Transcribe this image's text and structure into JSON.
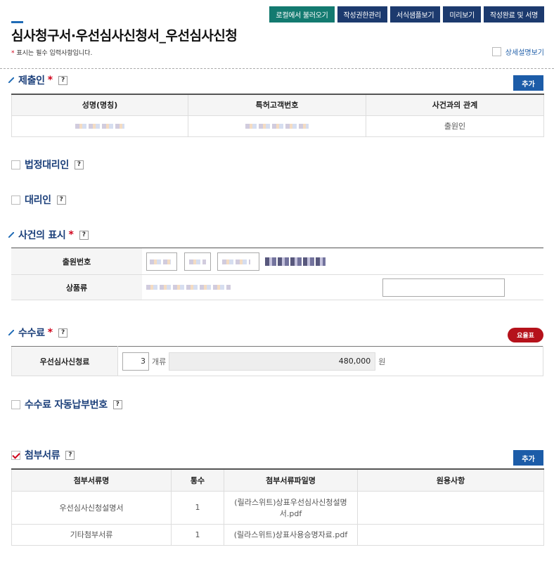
{
  "header": {
    "title": "심사청구서·우선심사신청서_우선심사신청",
    "required_note_star": "*",
    "required_note": "표시는 필수 입력사항입니다.",
    "detail_toggle_label": "상세설명보기"
  },
  "top_buttons": [
    {
      "label": "로컬에서 불러오기"
    },
    {
      "label": "작성권한관리"
    },
    {
      "label": "서식샘플보기"
    },
    {
      "label": "미리보기"
    },
    {
      "label": "작성완료 및 서명"
    }
  ],
  "sections": {
    "submitter": {
      "title": "제출인",
      "required": "*",
      "help": "?",
      "add_label": "추가"
    },
    "legal_agent": {
      "title": "법정대리인",
      "help": "?"
    },
    "agent": {
      "title": "대리인",
      "help": "?"
    },
    "case": {
      "title": "사건의 표시",
      "required": "*",
      "help": "?"
    },
    "fee": {
      "title": "수수료",
      "required": "*",
      "help": "?",
      "fee_table_label": "요율표"
    },
    "auto_pay": {
      "title": "수수료 자동납부번호",
      "help": "?"
    },
    "attachments": {
      "title": "첨부서류",
      "help": "?",
      "add_label": "추가"
    }
  },
  "submitter_table": {
    "headers": [
      "성명(명칭)",
      "특허고객번호",
      "사건과의 관계"
    ],
    "rows": [
      {
        "relation": "출원인"
      }
    ]
  },
  "case_table": {
    "rows": [
      {
        "label": "출원번호"
      },
      {
        "label": "상품류"
      }
    ]
  },
  "fee_table": {
    "label": "우선심사신청료",
    "quantity": "3",
    "quantity_unit": "개류",
    "amount": "480,000",
    "amount_unit": "원"
  },
  "attachment_table": {
    "headers": [
      "첨부서류명",
      "통수",
      "첨부서류파일명",
      "원용사항"
    ],
    "rows": [
      {
        "name": "우선심사신청설명서",
        "count": "1",
        "file": "(릴라스위트)상표우선심사신청설명서.pdf",
        "ref": ""
      },
      {
        "name": "기타첨부서류",
        "count": "1",
        "file": "(릴라스위트)상표사용승명자료.pdf",
        "ref": ""
      }
    ]
  },
  "colors": {
    "accent_green": "#137a70",
    "accent_navy": "#1c3a6e",
    "accent_blue": "#1c5ca8",
    "accent_red": "#b5121b",
    "section_title": "#1b3f7a"
  }
}
